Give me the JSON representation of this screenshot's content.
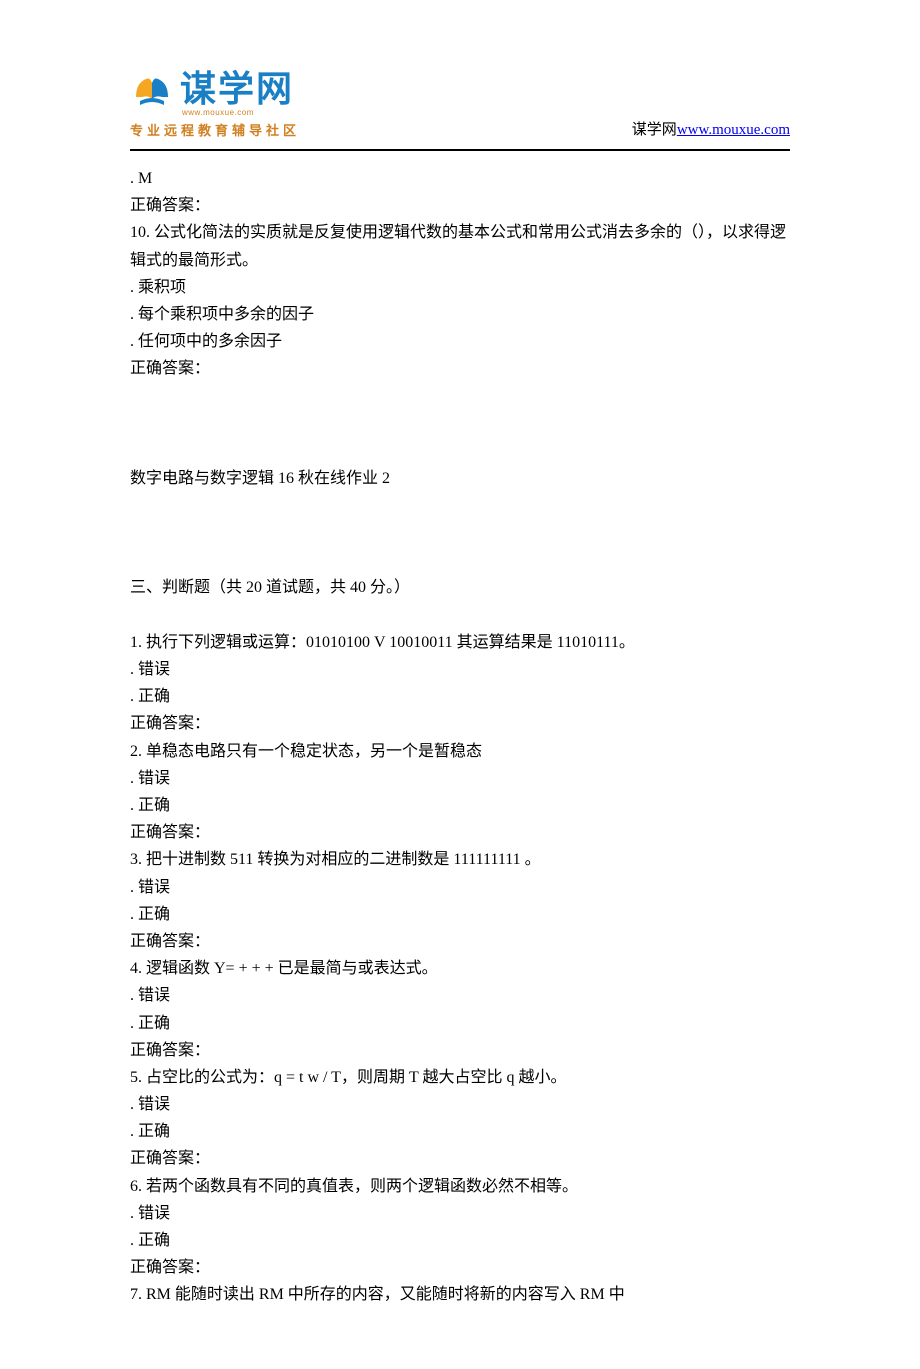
{
  "header": {
    "logo_text": "谋学网",
    "logo_url": "www.mouxue.com",
    "logo_subtitle": "专业远程教育辅导社区",
    "site_name": "谋学网",
    "site_link": "www.mouxue.com"
  },
  "prev_remainder": {
    "option": ". M",
    "answer_label": "正确答案："
  },
  "q10": {
    "prompt": "10.  公式化简法的实质就是反复使用逻辑代数的基本公式和常用公式消去多余的（），以求得逻辑式的最简形式。",
    "opt1": ". 乘积项",
    "opt2": ". 每个乘积项中多余的因子",
    "opt3": ". 任何项中的多余因子",
    "answer_label": "正确答案："
  },
  "section_title": "数字电路与数字逻辑 16 秋在线作业 2",
  "part_header": "三、判断题（共 20 道试题，共 40 分。）",
  "tf": {
    "wrong": ". 错误",
    "right": ". 正确",
    "answer_label": "正确答案："
  },
  "q1": {
    "prompt": "1.  执行下列逻辑或运算：01010100 V 10010011 其运算结果是 11010111。"
  },
  "q2": {
    "prompt": "2.  单稳态电路只有一个稳定状态，另一个是暂稳态"
  },
  "q3": {
    "prompt": "3.  把十进制数 511 转换为对相应的二进制数是 111111111 。"
  },
  "q4": {
    "prompt": "4.  逻辑函数 Y= + + + 已是最简与或表达式。"
  },
  "q5": {
    "prompt": "5.  占空比的公式为：q = t w / T，则周期 T 越大占空比 q 越小。"
  },
  "q6": {
    "prompt": "6.  若两个函数具有不同的真值表，则两个逻辑函数必然不相等。"
  },
  "q7": {
    "prompt": "7.  RM 能随时读出 RM 中所存的内容，又能随时将新的内容写入 RM 中"
  }
}
